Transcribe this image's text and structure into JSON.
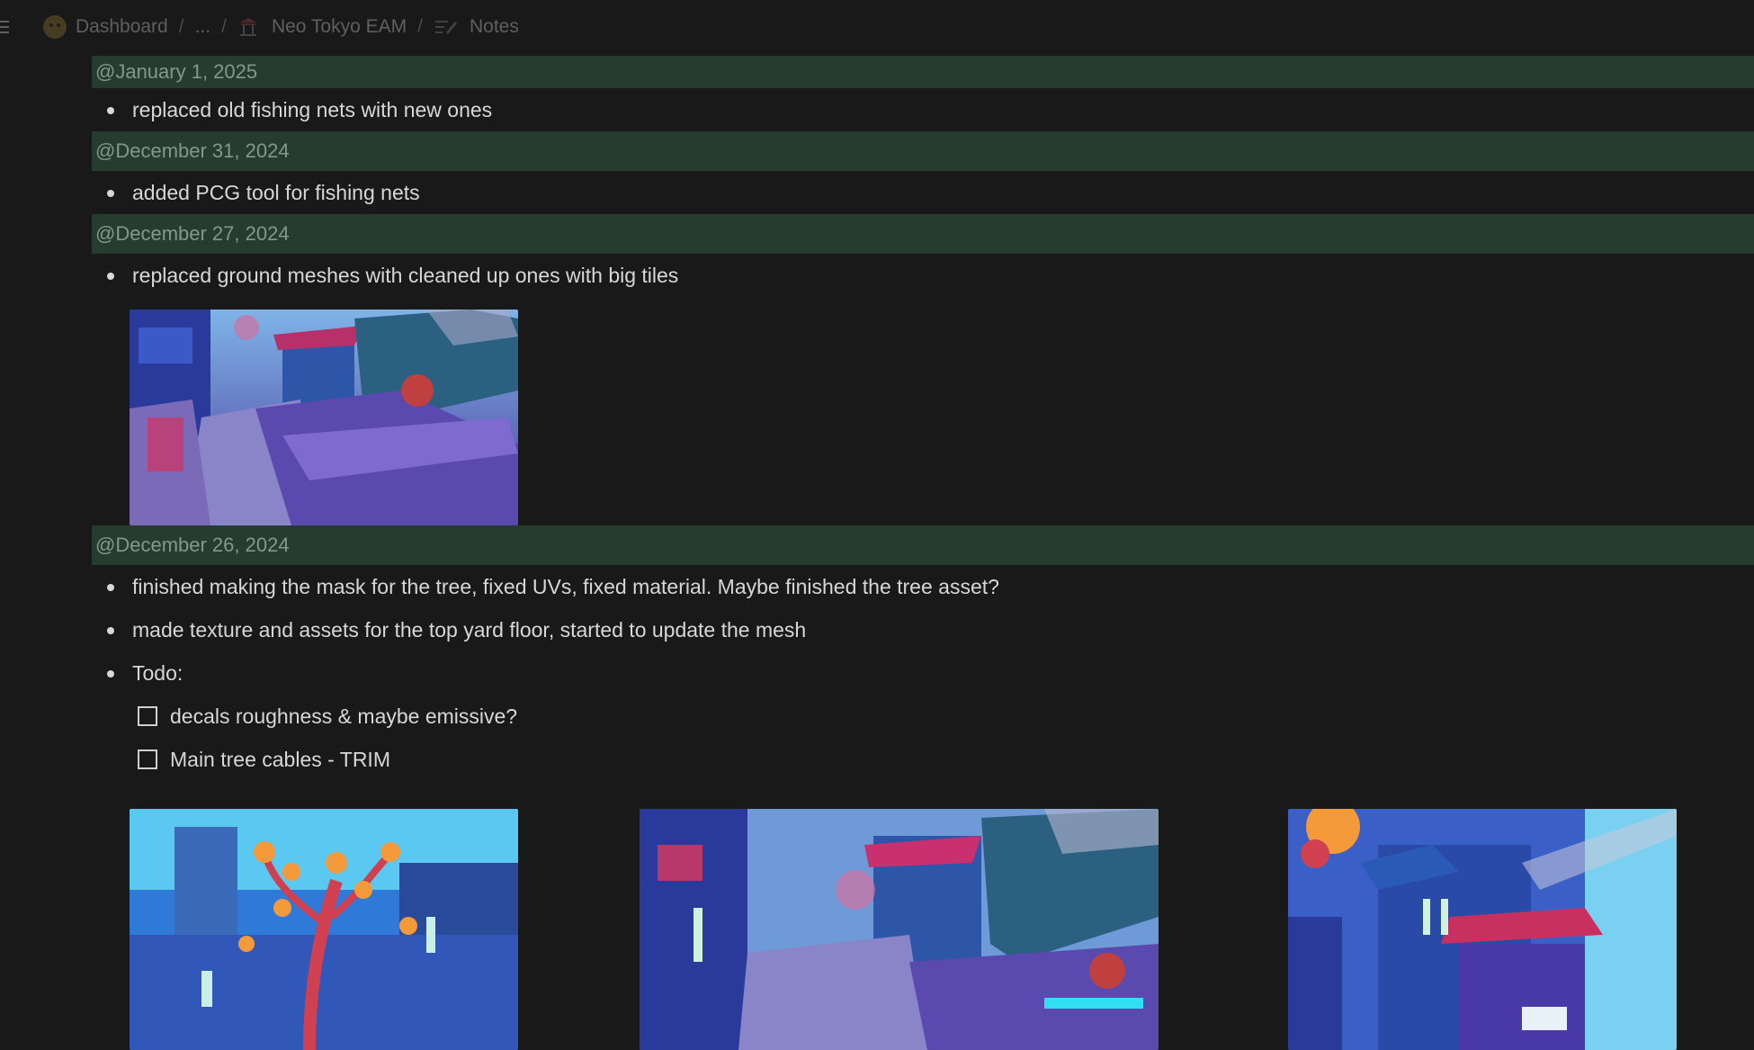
{
  "breadcrumb": {
    "items": [
      {
        "label": "Dashboard",
        "icon": "emoji-face-icon"
      },
      {
        "label": "...",
        "icon": null
      },
      {
        "label": "Neo Tokyo EAM",
        "icon": "temple-icon"
      },
      {
        "label": "Notes",
        "icon": "note-edit-icon"
      }
    ],
    "separator": "/"
  },
  "entries": [
    {
      "date": "@January 1, 2025",
      "bullets": [
        "replaced old fishing nets with new ones"
      ]
    },
    {
      "date": "@December 31, 2024",
      "bullets": [
        "added PCG tool for fishing nets"
      ]
    },
    {
      "date": "@December 27, 2024",
      "bullets": [
        "replaced ground meshes with cleaned up ones with big tiles"
      ]
    },
    {
      "date": "@December 26, 2024",
      "bullets": [
        "finished making the mask for the tree, fixed UVs, fixed material. Maybe finished the tree asset?",
        "made texture and assets for the top yard floor, started to update the mesh",
        "Todo:"
      ],
      "todos": [
        {
          "label": "decals roughness & maybe emissive?",
          "checked": false
        },
        {
          "label": "Main tree cables - TRIM",
          "checked": false
        }
      ]
    }
  ],
  "colors": {
    "background": "#191919",
    "date_highlight": "#263c2f",
    "date_text": "#7f9a8a",
    "body_text": "#d7d7d7"
  }
}
